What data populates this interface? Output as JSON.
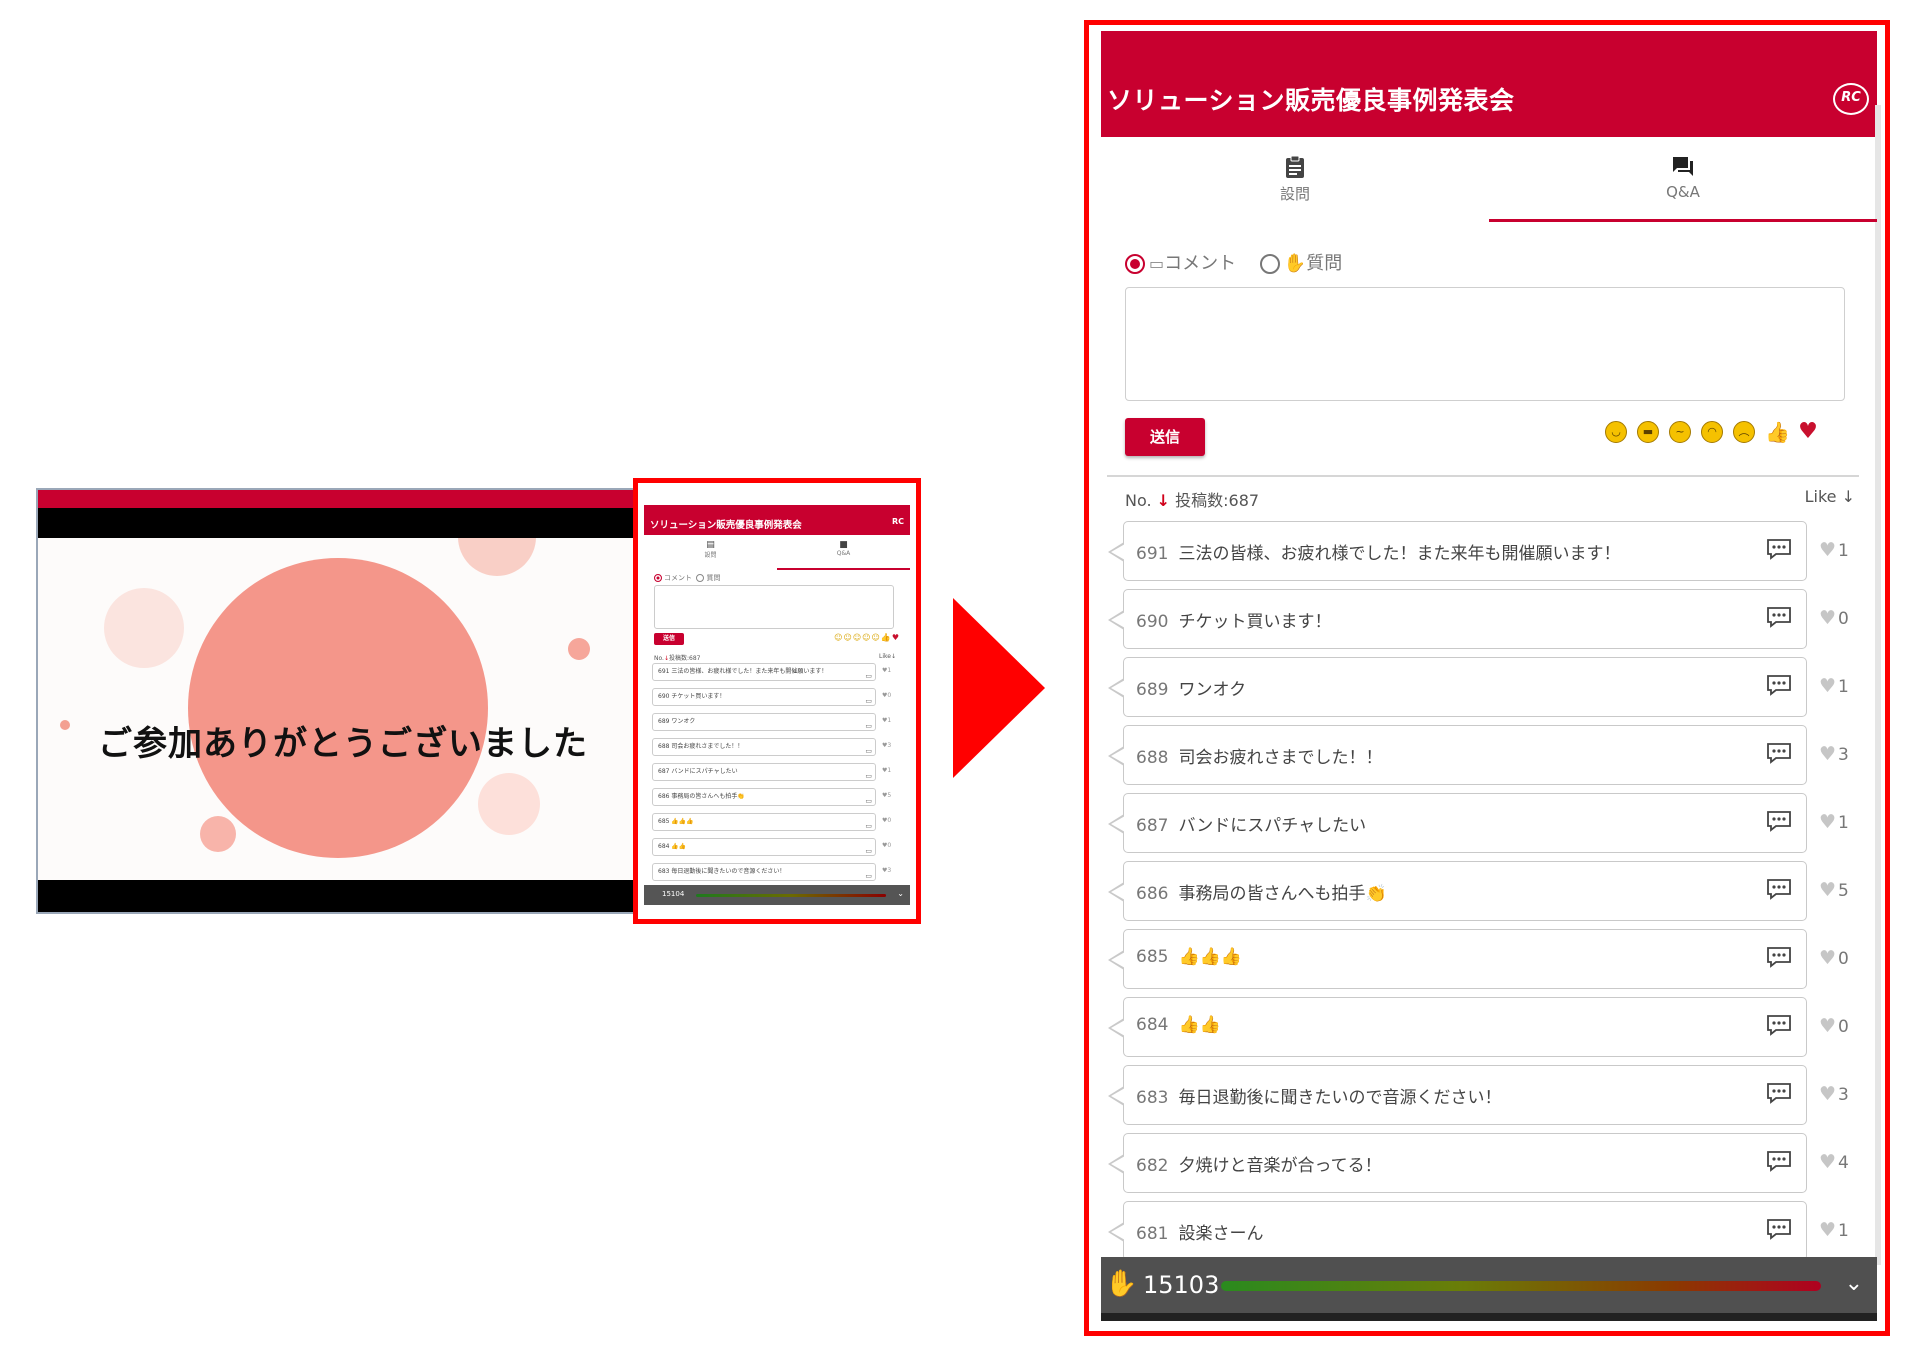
{
  "slide": {
    "thanks_text": "ご参加ありがとうございました"
  },
  "panel": {
    "title": "ソリューション販売優良事例発表会",
    "logo_text": "RC",
    "tabs": [
      {
        "label": "設問",
        "icon": "clipboard-icon",
        "active": false
      },
      {
        "label": "Q&A",
        "icon": "chat-icon",
        "active": true
      }
    ],
    "post_types": [
      {
        "label": "コメント",
        "icon": "comment-icon",
        "selected": true
      },
      {
        "label": "質問",
        "icon": "raised-hand-icon",
        "selected": false
      }
    ],
    "send_label": "送信",
    "reactions": [
      "smile-face",
      "grin-face",
      "thinking-face",
      "frown-face",
      "angry-face",
      "thumbs-up",
      "heart"
    ],
    "sort_prefix": "No.",
    "post_count_label": "投稿数:687",
    "like_sort_label": "Like",
    "comments": [
      {
        "no": "691",
        "text": "三法の皆様、お疲れ様でした！また来年も開催願います！",
        "likes": "1"
      },
      {
        "no": "690",
        "text": "チケット買います！",
        "likes": "0"
      },
      {
        "no": "689",
        "text": "ワンオク",
        "likes": "1"
      },
      {
        "no": "688",
        "text": "司会お疲れさまでした！！",
        "likes": "3"
      },
      {
        "no": "687",
        "text": "バンドにスパチャしたい",
        "likes": "1"
      },
      {
        "no": "686",
        "text": "事務局の皆さんへも拍手👏",
        "likes": "5"
      },
      {
        "no": "685",
        "text": "👍👍👍",
        "likes": "0"
      },
      {
        "no": "684",
        "text": "👍👍",
        "likes": "0"
      },
      {
        "no": "683",
        "text": "毎日退勤後に聞きたいので音源ください！",
        "likes": "3"
      },
      {
        "no": "682",
        "text": "夕焼けと音楽が合ってる！",
        "likes": "4"
      },
      {
        "no": "681",
        "text": "設楽さーん",
        "likes": "1"
      }
    ],
    "clap_count": "15103"
  },
  "mini_panel": {
    "clap_count": "15104",
    "comments": [
      {
        "no": "691",
        "text": "三法の皆様、お疲れ様でした！また来年も開催願います！",
        "likes": "1"
      },
      {
        "no": "690",
        "text": "チケット買います！",
        "likes": "0"
      },
      {
        "no": "689",
        "text": "ワンオク",
        "likes": "1"
      },
      {
        "no": "688",
        "text": "司会お疲れさまでした！！",
        "likes": "3"
      },
      {
        "no": "687",
        "text": "バンドにスパチャしたい",
        "likes": "1"
      },
      {
        "no": "686",
        "text": "事務局の皆さんへも拍手👏",
        "likes": "5"
      },
      {
        "no": "685",
        "text": "👍👍👍",
        "likes": "0"
      },
      {
        "no": "684",
        "text": "👍👍",
        "likes": "0"
      },
      {
        "no": "683",
        "text": "毎日退勤後に聞きたいので音源ください！",
        "likes": "3"
      }
    ]
  },
  "colors": {
    "brand_red": "#c8002f",
    "highlight_red": "#ff0000",
    "slide_circle": "#f4968a"
  }
}
